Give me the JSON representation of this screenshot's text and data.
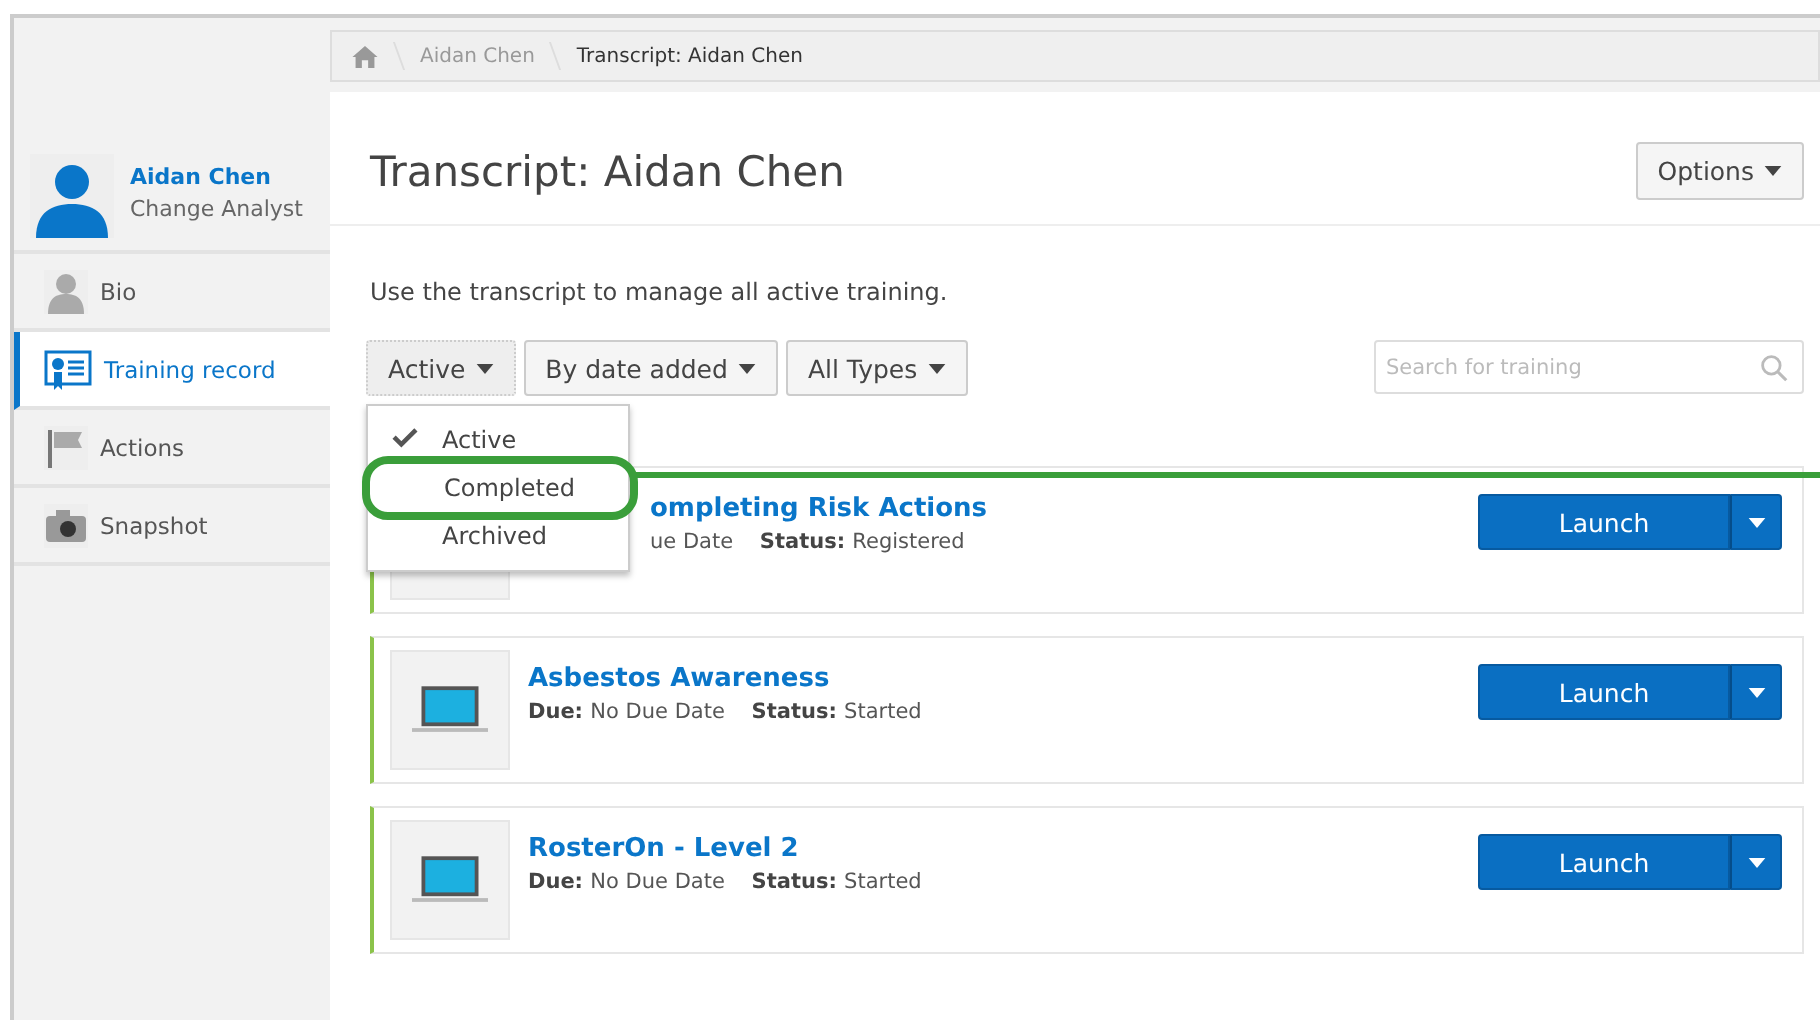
{
  "breadcrumb": [
    {
      "label": "Aidan Chen",
      "current": false
    },
    {
      "label": "Transcript: Aidan Chen",
      "current": true
    }
  ],
  "profile": {
    "name": "Aidan Chen",
    "role": "Change Analyst"
  },
  "sidebar": {
    "items": [
      {
        "label": "Bio",
        "kind": "person",
        "selected": false
      },
      {
        "label": "Training record",
        "kind": "certificate",
        "selected": true
      },
      {
        "label": "Actions",
        "kind": "flag",
        "selected": false
      },
      {
        "label": "Snapshot",
        "kind": "camera",
        "selected": false
      }
    ]
  },
  "page_title": "Transcript: Aidan Chen",
  "options_button": "Options",
  "intro": "Use the transcript to manage all active training.",
  "filters": [
    {
      "label": "Active",
      "open": true
    },
    {
      "label": "By date added",
      "open": false
    },
    {
      "label": "All Types",
      "open": false
    }
  ],
  "status_menu": [
    {
      "label": "Active",
      "selected": true,
      "highlighted": false
    },
    {
      "label": "Completed",
      "selected": false,
      "highlighted": true
    },
    {
      "label": "Archived",
      "selected": false,
      "highlighted": false
    }
  ],
  "search": {
    "placeholder": "Search for training"
  },
  "trainings": [
    {
      "title": "ompleting Risk Actions",
      "due": "ue Date",
      "status_label": "Status:",
      "status": "Registered",
      "action": "Launch",
      "covered": true
    },
    {
      "title": "Asbestos Awareness",
      "due_label": "Due:",
      "due": "No Due Date",
      "status_label": "Status:",
      "status": "Started",
      "action": "Launch",
      "covered": false
    },
    {
      "title": "RosterOn - Level 2",
      "due_label": "Due:",
      "due": "No Due Date",
      "status_label": "Status:",
      "status": "Started",
      "action": "Launch",
      "covered": false
    }
  ]
}
